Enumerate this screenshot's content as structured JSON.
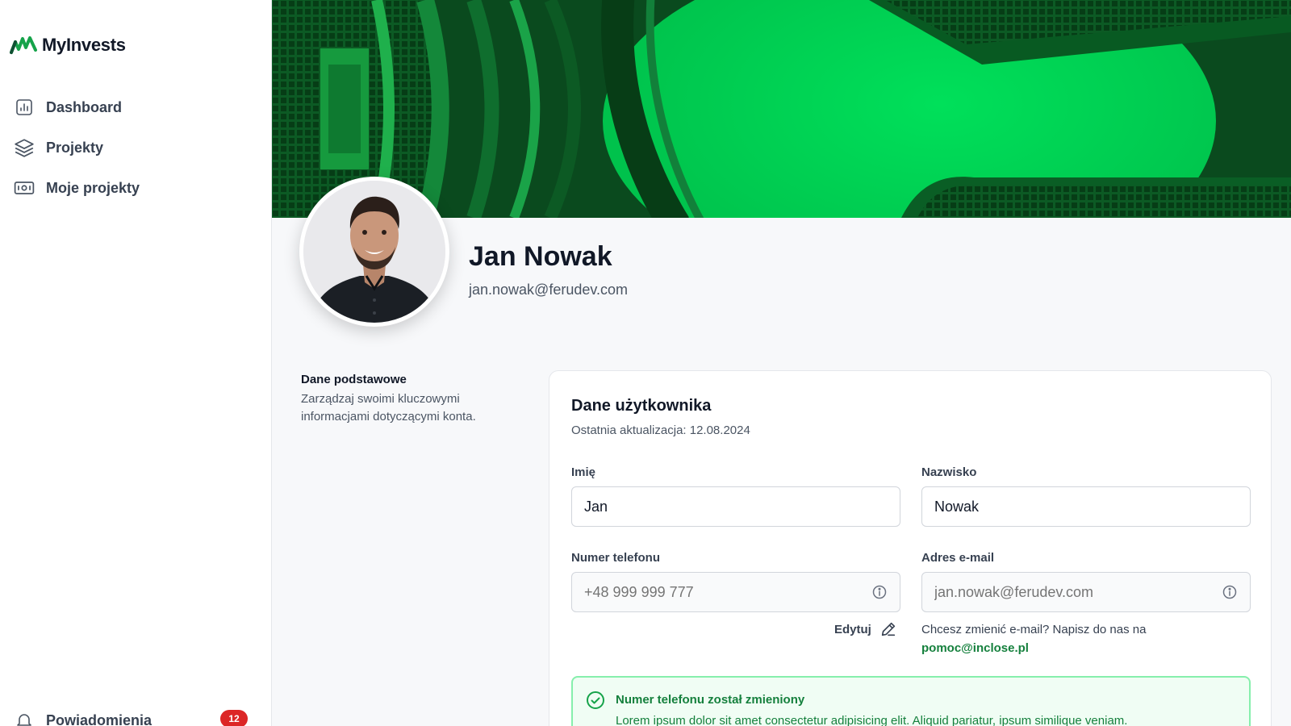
{
  "app": {
    "brand": "MyInvests",
    "brand_color": "#16a34a"
  },
  "sidebar": {
    "items": [
      {
        "label": "Dashboard",
        "icon": "chart-icon"
      },
      {
        "label": "Projekty",
        "icon": "layers-icon"
      },
      {
        "label": "Moje projekty",
        "icon": "banknote-icon"
      }
    ],
    "notifications": {
      "label": "Powiadomienia",
      "count": "12",
      "icon": "bell-icon"
    }
  },
  "profile": {
    "name": "Jan Nowak",
    "email": "jan.nowak@ferudev.com"
  },
  "section": {
    "title": "Dane podstawowe",
    "description": "Zarządzaj swoimi kluczowymi informacjami dotyczącymi konta."
  },
  "card": {
    "title": "Dane użytkownika",
    "updated": "Ostatnia aktualizacja: 12.08.2024",
    "fields": {
      "first_name": {
        "label": "Imię",
        "value": "Jan"
      },
      "last_name": {
        "label": "Nazwisko",
        "value": "Nowak"
      },
      "phone": {
        "label": "Numer telefonu",
        "placeholder": "+48 999 999 777"
      },
      "email": {
        "label": "Adres e-mail",
        "placeholder": "jan.nowak@ferudev.com"
      }
    },
    "edit_label": "Edytuj",
    "email_note": "Chcesz zmienić e-mail? Napisz do nas na",
    "support_email": "pomoc@inclose.pl"
  },
  "alert": {
    "title": "Numer telefonu został zmieniony",
    "text": "Lorem ipsum dolor sit amet consectetur adipisicing elit. Aliquid pariatur, ipsum similique veniam.",
    "color": "#15803d"
  }
}
